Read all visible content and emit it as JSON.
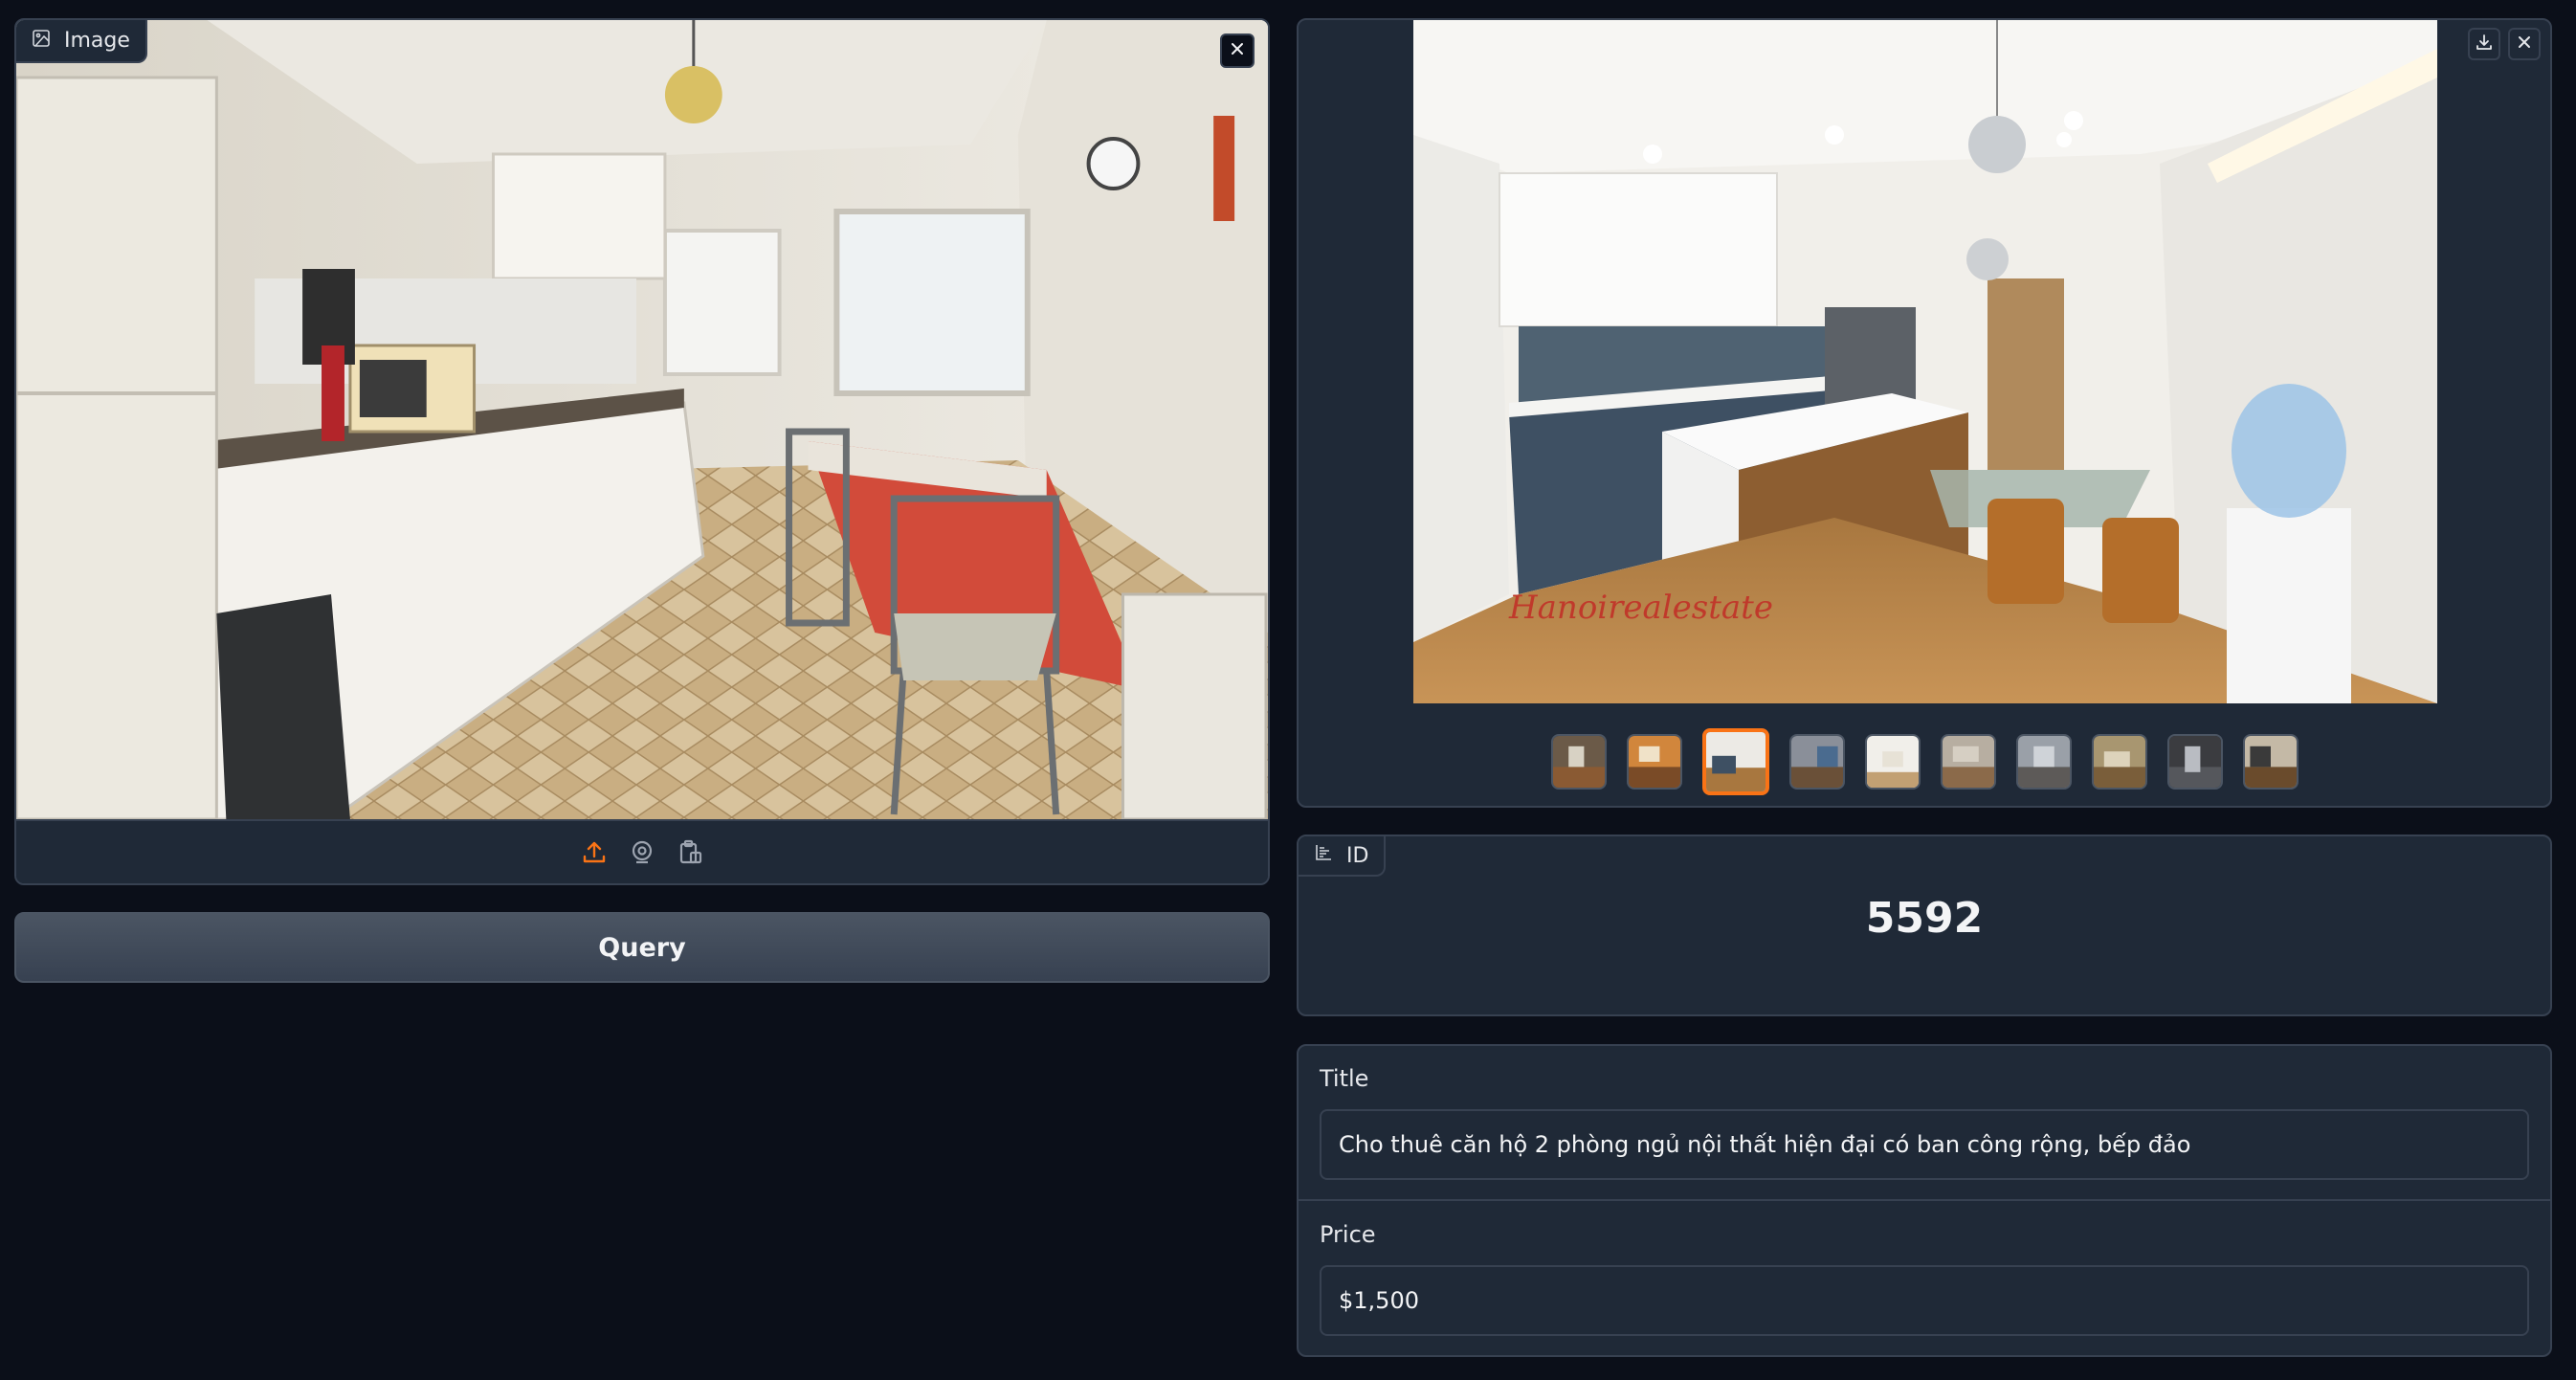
{
  "input_image": {
    "label": "Image",
    "icons": [
      "image-icon",
      "close-icon",
      "upload-icon",
      "webcam-icon",
      "clipboard-icon"
    ]
  },
  "query_button": {
    "label": "Query"
  },
  "gallery": {
    "icons": [
      "download-icon",
      "close-icon"
    ],
    "thumbnail_count": 10,
    "selected_thumbnail_index": 2,
    "watermark": "Hanoi realestate"
  },
  "id_block": {
    "label": "ID",
    "value": "5592",
    "icon": "bar-chart-icon"
  },
  "title_field": {
    "label": "Title",
    "value": "Cho thuê căn hộ 2 phòng ngủ nội thất hiện đại có ban công rộng, bếp đảo"
  },
  "price_field": {
    "label": "Price",
    "value": "$1,500"
  },
  "colors": {
    "background": "#0b0f19",
    "panel": "#1f2937",
    "border": "#374151",
    "accent": "#f97316"
  }
}
